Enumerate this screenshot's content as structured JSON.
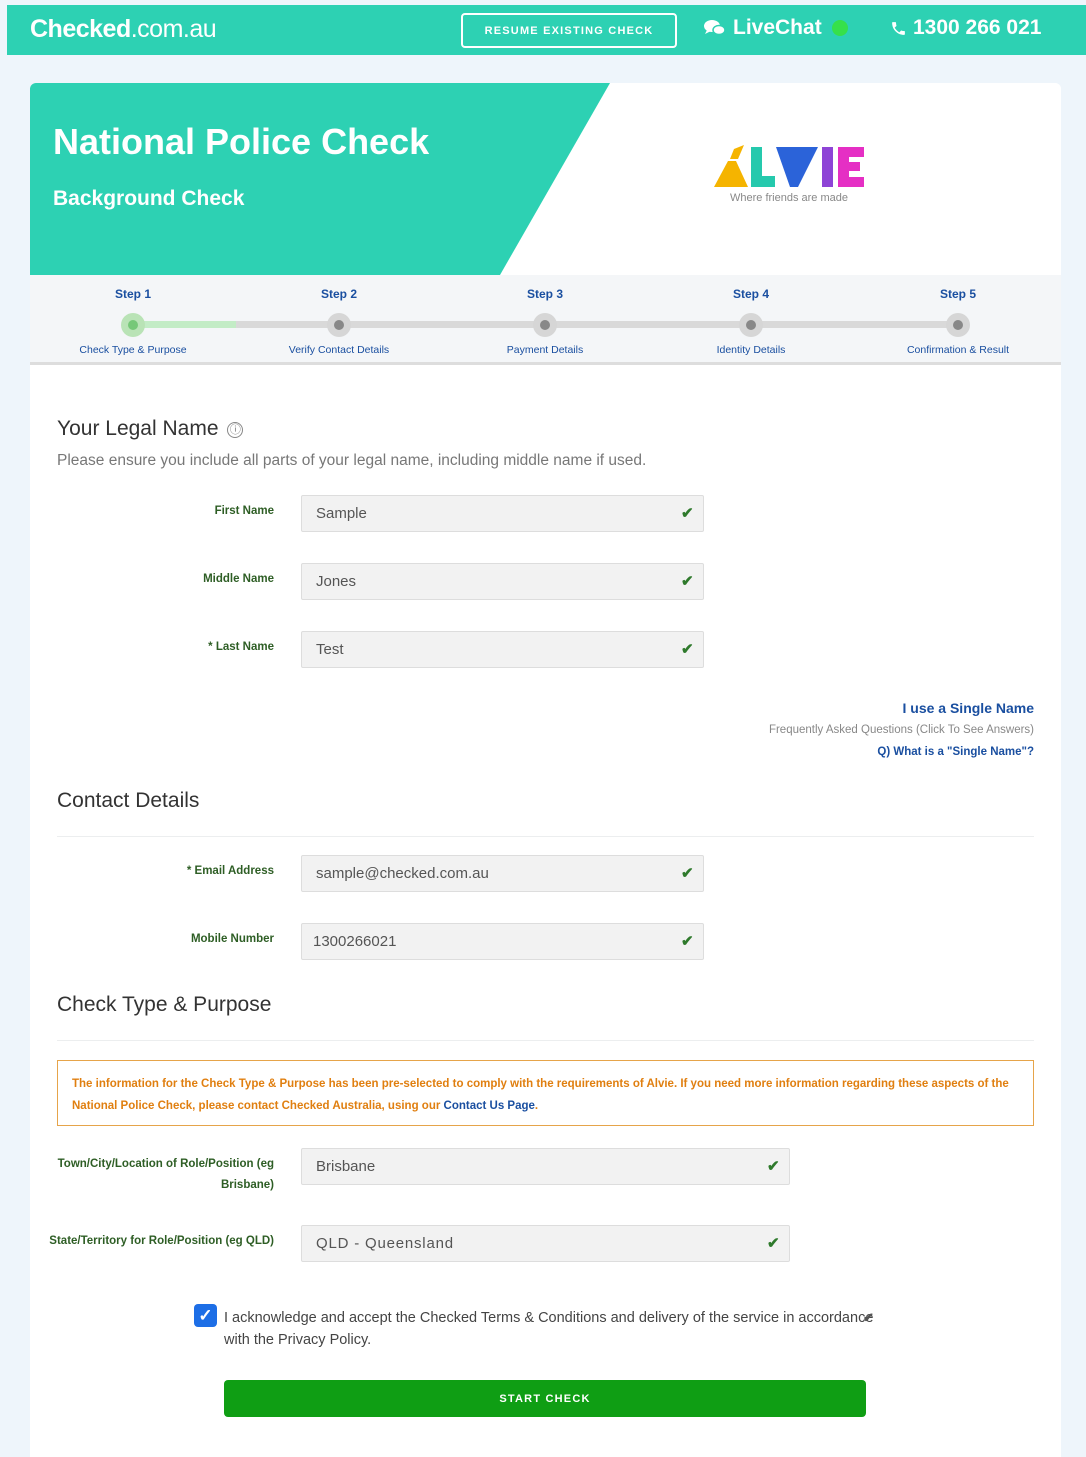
{
  "header": {
    "logo_bold": "Checked",
    "logo_light": ".com.au",
    "resume_label": "RESUME EXISTING CHECK",
    "livechat_label": "LiveChat",
    "phone_label": "1300 266 021",
    "brand_color": "#2dd1b3"
  },
  "hero": {
    "title": "National Police Check",
    "subtitle": "Background Check",
    "partner_logo": "ALVIE",
    "partner_tagline": "Where friends are made"
  },
  "steps": [
    {
      "title": "Step 1",
      "label": "Check Type & Purpose",
      "active": true
    },
    {
      "title": "Step 2",
      "label": "Verify Contact Details",
      "active": false
    },
    {
      "title": "Step 3",
      "label": "Payment Details",
      "active": false
    },
    {
      "title": "Step 4",
      "label": "Identity Details",
      "active": false
    },
    {
      "title": "Step 5",
      "label": "Confirmation & Result",
      "active": false
    }
  ],
  "legal_name": {
    "title": "Your Legal Name",
    "info_icon": "ⓘ",
    "description": "Please ensure you include all parts of your legal name, including middle name if used.",
    "first_label": "First Name",
    "first_value": "Sample",
    "middle_label": "Middle Name",
    "middle_value": "Jones",
    "last_label": "* Last Name",
    "last_value": "Test",
    "single_name_link": "I use a Single Name",
    "faq_title": "Frequently Asked Questions (Click To See Answers)",
    "faq_question": "Q) What is a \"Single Name\"?"
  },
  "contact": {
    "title": "Contact Details",
    "email_label": "* Email Address",
    "email_value": "sample@checked.com.au",
    "mobile_label": "Mobile Number",
    "mobile_value": "1300266021"
  },
  "check_type": {
    "title": "Check Type & Purpose",
    "notice_text": "The information for the Check Type & Purpose has been pre-selected to comply with the requirements of Alvie. If you need more information regarding these aspects of the National Police Check, please contact Checked Australia, using our ",
    "notice_link": "Contact Us Page",
    "notice_end": ".",
    "town_label": "Town/City/Location of Role/Position (eg Brisbane)",
    "town_value": "Brisbane",
    "state_label": "State/Territory for Role/Position (eg QLD)",
    "state_value": "QLD - Queensland"
  },
  "terms": {
    "checked": true,
    "text": "I acknowledge and accept the Checked Terms & Conditions and delivery of the service in accordance with the Privacy Policy."
  },
  "start_label": "START CHECK"
}
